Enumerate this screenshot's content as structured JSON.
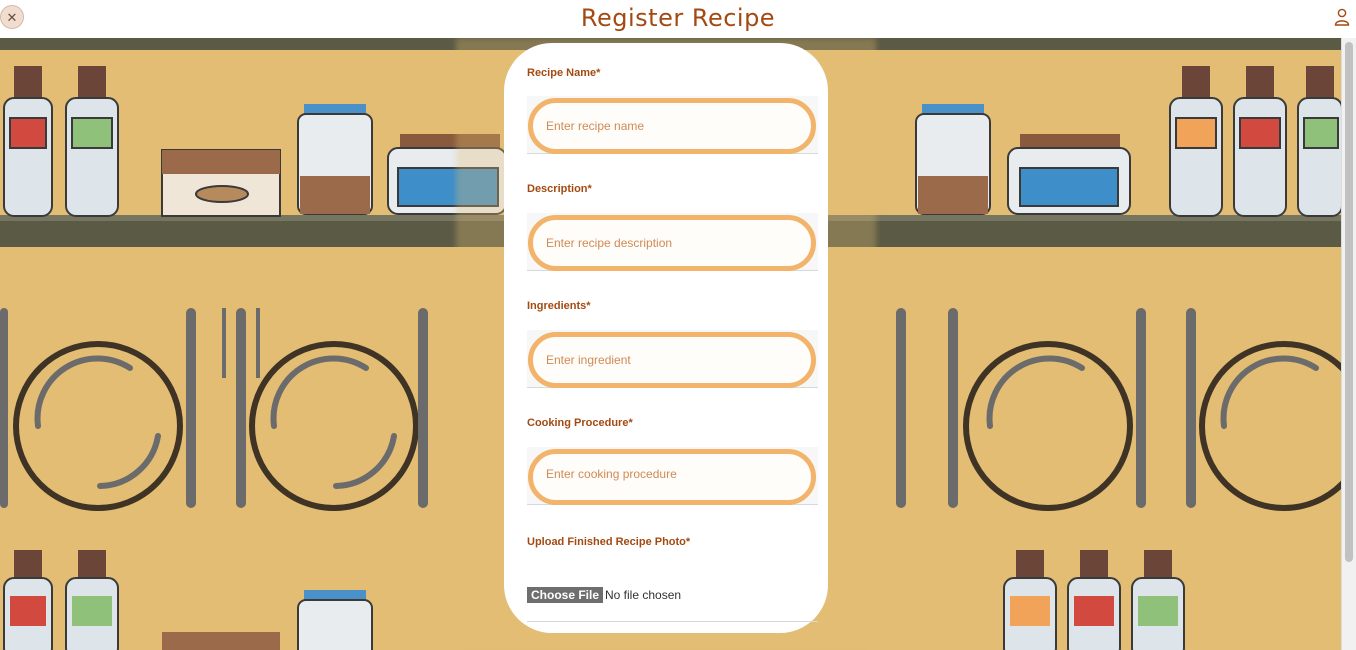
{
  "header": {
    "title": "Register Recipe",
    "logo_icon": "utensils-icon",
    "user_icon": "user-icon"
  },
  "form": {
    "recipe_name": {
      "label": "Recipe Name*",
      "placeholder": "Enter recipe name",
      "value": ""
    },
    "description": {
      "label": "Description*",
      "placeholder": "Enter recipe description",
      "value": ""
    },
    "ingredients": {
      "label": "Ingredients*",
      "placeholder": "Enter ingredient",
      "value": ""
    },
    "procedure": {
      "label": "Cooking Procedure*",
      "placeholder": "Enter cooking procedure",
      "value": ""
    },
    "photo": {
      "label": "Upload Finished Recipe Photo*",
      "button": "Choose File",
      "status": "No file chosen"
    }
  },
  "colors": {
    "accent": "#a34a12",
    "input_border": "#f2b36b",
    "background": "#e2bd73",
    "shelf": "#5b5a45"
  }
}
